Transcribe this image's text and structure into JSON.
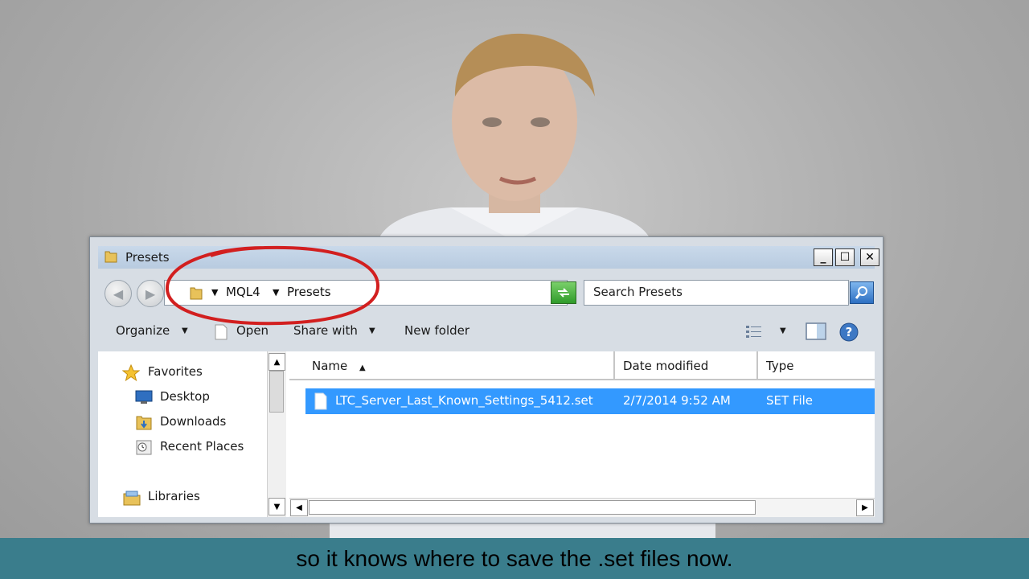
{
  "window": {
    "title": "Presets",
    "controls": {
      "minimize": "_",
      "maximize": "☐",
      "close": "✕"
    }
  },
  "address_bar": {
    "crumbs": [
      "MQL4",
      "Presets"
    ],
    "search_placeholder": "Search Presets"
  },
  "toolbar": {
    "organize": "Organize",
    "open": "Open",
    "share_with": "Share with",
    "new_folder": "New folder"
  },
  "nav_pane": {
    "items": [
      {
        "label": "Favorites",
        "icon": "star-icon"
      },
      {
        "label": "Desktop",
        "icon": "desktop-icon"
      },
      {
        "label": "Downloads",
        "icon": "downloads-folder-icon"
      },
      {
        "label": "Recent Places",
        "icon": "recent-places-icon"
      },
      {
        "label": "Libraries",
        "icon": "libraries-icon"
      }
    ]
  },
  "file_list": {
    "columns": [
      "Name",
      "Date modified",
      "Type"
    ],
    "rows": [
      {
        "name": "LTC_Server_Last_Known_Settings_5412.set",
        "date": "2/7/2014 9:52 AM",
        "type": "SET File",
        "selected": true
      }
    ]
  },
  "caption": "so it knows where to save the .set files now.",
  "colors": {
    "selection": "#3399ff",
    "caption_band": "#3a7d8c",
    "annotation_circle": "#d21f1f"
  }
}
